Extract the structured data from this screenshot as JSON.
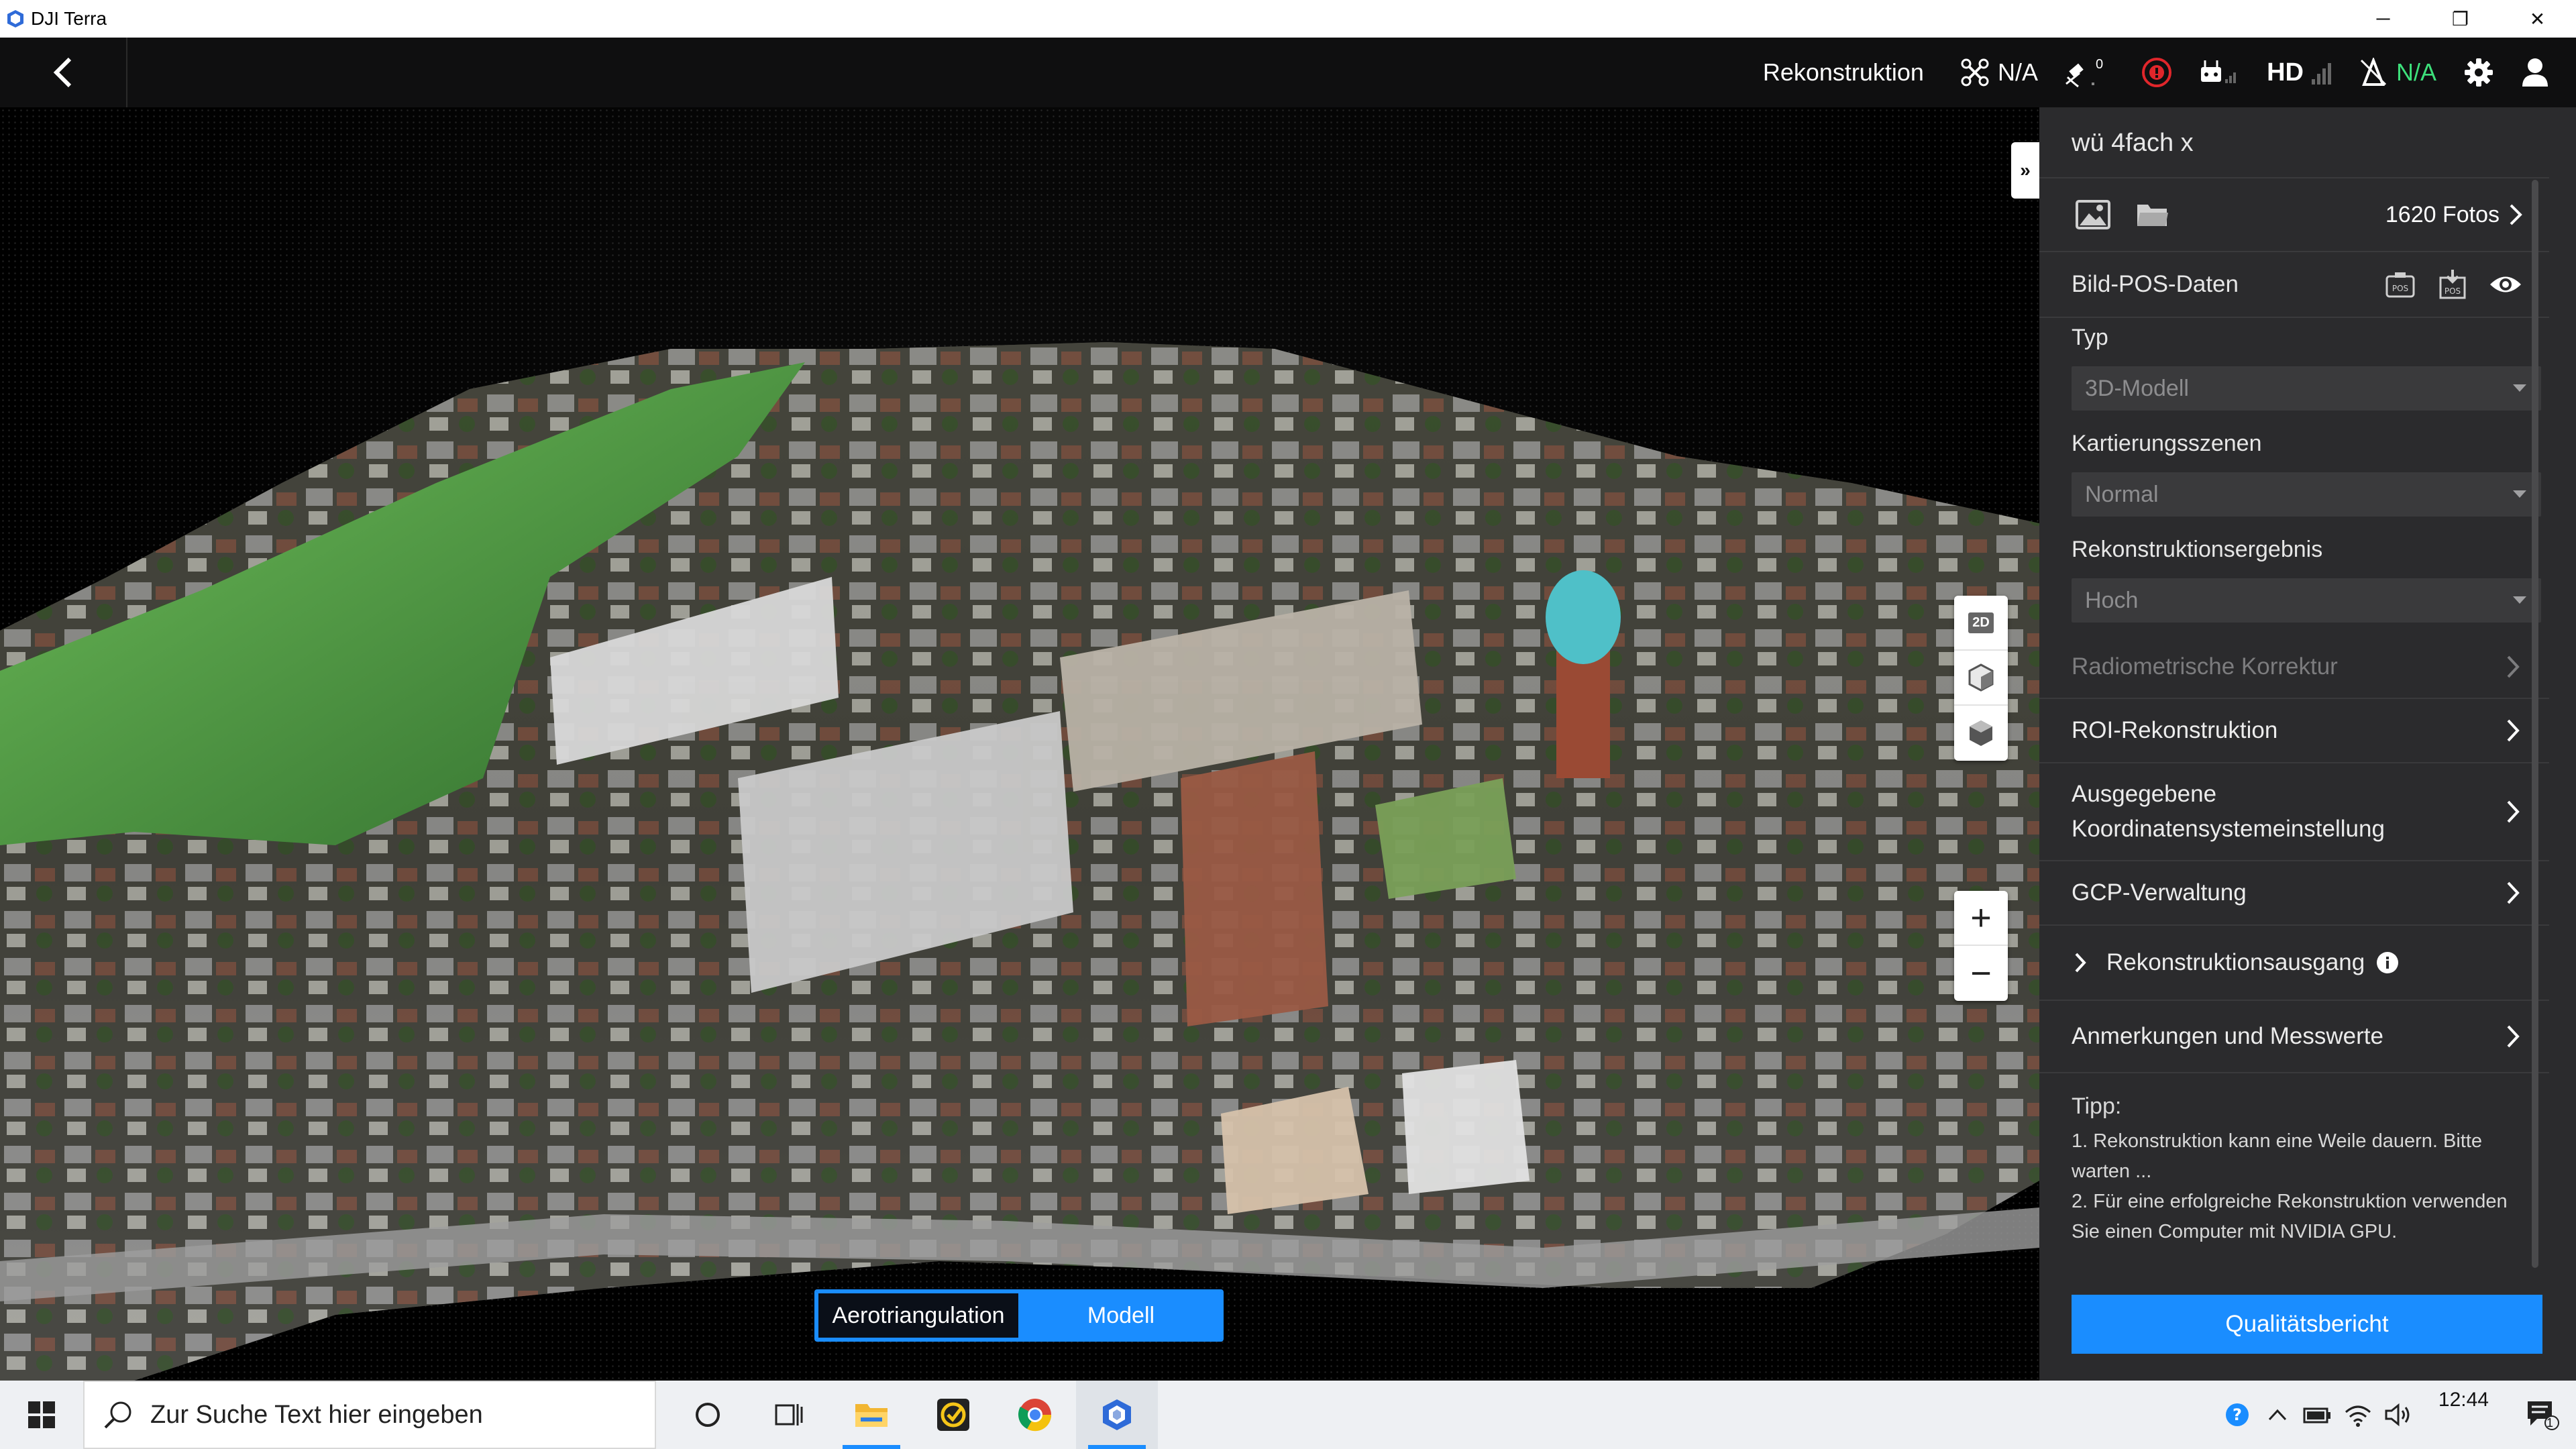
{
  "window": {
    "title": "DJI Terra",
    "minimize": "─",
    "restore": "❐",
    "close": "✕"
  },
  "appbar": {
    "mode_label": "Rekonstruktion",
    "drone_status": "N/A",
    "gnss_count": "0",
    "hd_label": "HD",
    "rtk_status": "N/A",
    "colors": {
      "rtk": "#3de07b",
      "alert": "#e0262b"
    }
  },
  "viewport": {
    "collapse_icon": "»",
    "tools": [
      "2d-view-icon",
      "3d-box-icon",
      "3d-solid-box-icon"
    ],
    "tool_2d_label": "2D",
    "zoom_in": "+",
    "zoom_out": "−",
    "toggle": {
      "left": "Aerotriangulation",
      "right": "Modell",
      "selected": "Modell"
    }
  },
  "panel": {
    "project_name": "wü 4fach x",
    "photos_count": "1620 Fotos",
    "pos_label": "Bild-POS-Daten",
    "typ": {
      "label": "Typ",
      "value": "3D-Modell"
    },
    "kartierung": {
      "label": "Kartierungsszenen",
      "value": "Normal"
    },
    "ergebnis": {
      "label": "Rekonstruktionsergebnis",
      "value": "Hoch"
    },
    "nav": {
      "radiometric": "Radiometrische Korrektur",
      "roi": "ROI-Rekonstruktion",
      "coord_line1": "Ausgegebene",
      "coord_line2": "Koordinatensystemeinstellung",
      "gcp": "GCP-Verwaltung",
      "output": "Rekonstruktionsausgang",
      "annotations": "Anmerkungen und Messwerte"
    },
    "tips": {
      "title": "Tipp:",
      "line1": "1. Rekonstruktion kann eine Weile dauern. Bitte warten ...",
      "line2": "2. Für eine erfolgreiche Rekonstruktion verwenden Sie einen Computer mit NVIDIA GPU."
    },
    "quality_button": "Qualitätsbericht",
    "accent": "#1a8dff"
  },
  "taskbar": {
    "search_placeholder": "Zur Suche Text hier eingeben",
    "clock": "12:44",
    "notification_count": "1"
  }
}
